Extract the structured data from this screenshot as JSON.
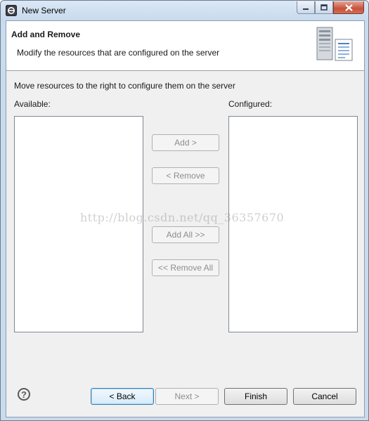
{
  "window": {
    "title": "New Server",
    "controls": {
      "minimize": "minimize",
      "maximize": "maximize",
      "close": "close"
    }
  },
  "header": {
    "title": "Add and Remove",
    "description": "Modify the resources that are configured on the server",
    "icon": "server-config-icon"
  },
  "main": {
    "instruction": "Move resources to the right to configure them on the server",
    "available_label": "Available:",
    "configured_label": "Configured:",
    "available_items": [],
    "configured_items": [],
    "buttons": {
      "add": "Add >",
      "remove": "< Remove",
      "add_all": "Add All >>",
      "remove_all": "<< Remove All"
    }
  },
  "watermark": "http://blog.csdn.net/qq_36357670",
  "footer": {
    "help_icon": "?",
    "back": "< Back",
    "next": "Next >",
    "finish": "Finish",
    "cancel": "Cancel"
  },
  "colors": {
    "titlebar": "#c8daee",
    "dialog_bg": "#f0f0f0",
    "close_button": "#c7513a",
    "default_button_border": "#3c7fb1"
  }
}
